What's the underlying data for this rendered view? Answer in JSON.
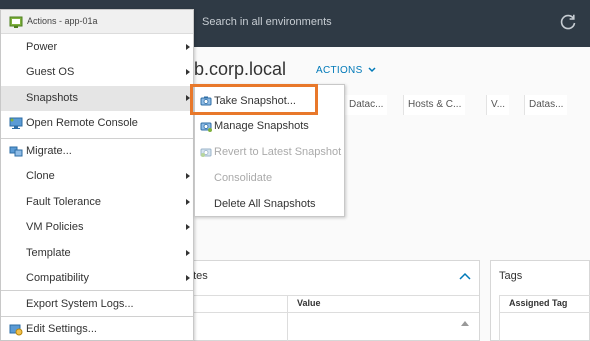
{
  "header": {
    "search_placeholder": "Search in all environments",
    "refresh_icon": "refresh-icon"
  },
  "main": {
    "title": "b.corp.local",
    "actions_label": "ACTIONS",
    "tabs": [
      "Datac...",
      "Hosts & C...",
      "V...",
      "Datas..."
    ],
    "attributes_panel": {
      "title": "utes",
      "columns": [
        "Value"
      ]
    },
    "tags_panel": {
      "title": "Tags",
      "columns": [
        "Assigned Tag"
      ]
    }
  },
  "context_menu": {
    "title": "Actions - app-01a",
    "items": [
      {
        "label": "Power",
        "submenu": true
      },
      {
        "label": "Guest OS",
        "submenu": true
      },
      {
        "label": "Snapshots",
        "submenu": true,
        "active": true
      },
      {
        "label": "Open Remote Console",
        "icon": "remote-console-icon"
      },
      {
        "label": "Migrate...",
        "icon": "migrate-icon"
      },
      {
        "label": "Clone",
        "submenu": true
      },
      {
        "label": "Fault Tolerance",
        "submenu": true
      },
      {
        "label": "VM Policies",
        "submenu": true
      },
      {
        "label": "Template",
        "submenu": true
      },
      {
        "label": "Compatibility",
        "submenu": true
      },
      {
        "label": "Export System Logs..."
      },
      {
        "label": "Edit Settings...",
        "icon": "edit-settings-icon"
      }
    ]
  },
  "snapshots_submenu": {
    "items": [
      {
        "label": "Take Snapshot...",
        "icon": "take-snapshot-icon",
        "highlighted": true
      },
      {
        "label": "Manage Snapshots",
        "icon": "manage-snapshots-icon"
      },
      {
        "label": "Revert to Latest Snapshot",
        "icon": "revert-snapshot-icon",
        "disabled": true
      },
      {
        "label": "Consolidate",
        "disabled": true
      },
      {
        "label": "Delete All Snapshots"
      }
    ]
  },
  "colors": {
    "header_bg": "#2f3a45",
    "accent": "#0079b8",
    "highlight": "#e8782a",
    "hover": "#e5e5e5"
  }
}
